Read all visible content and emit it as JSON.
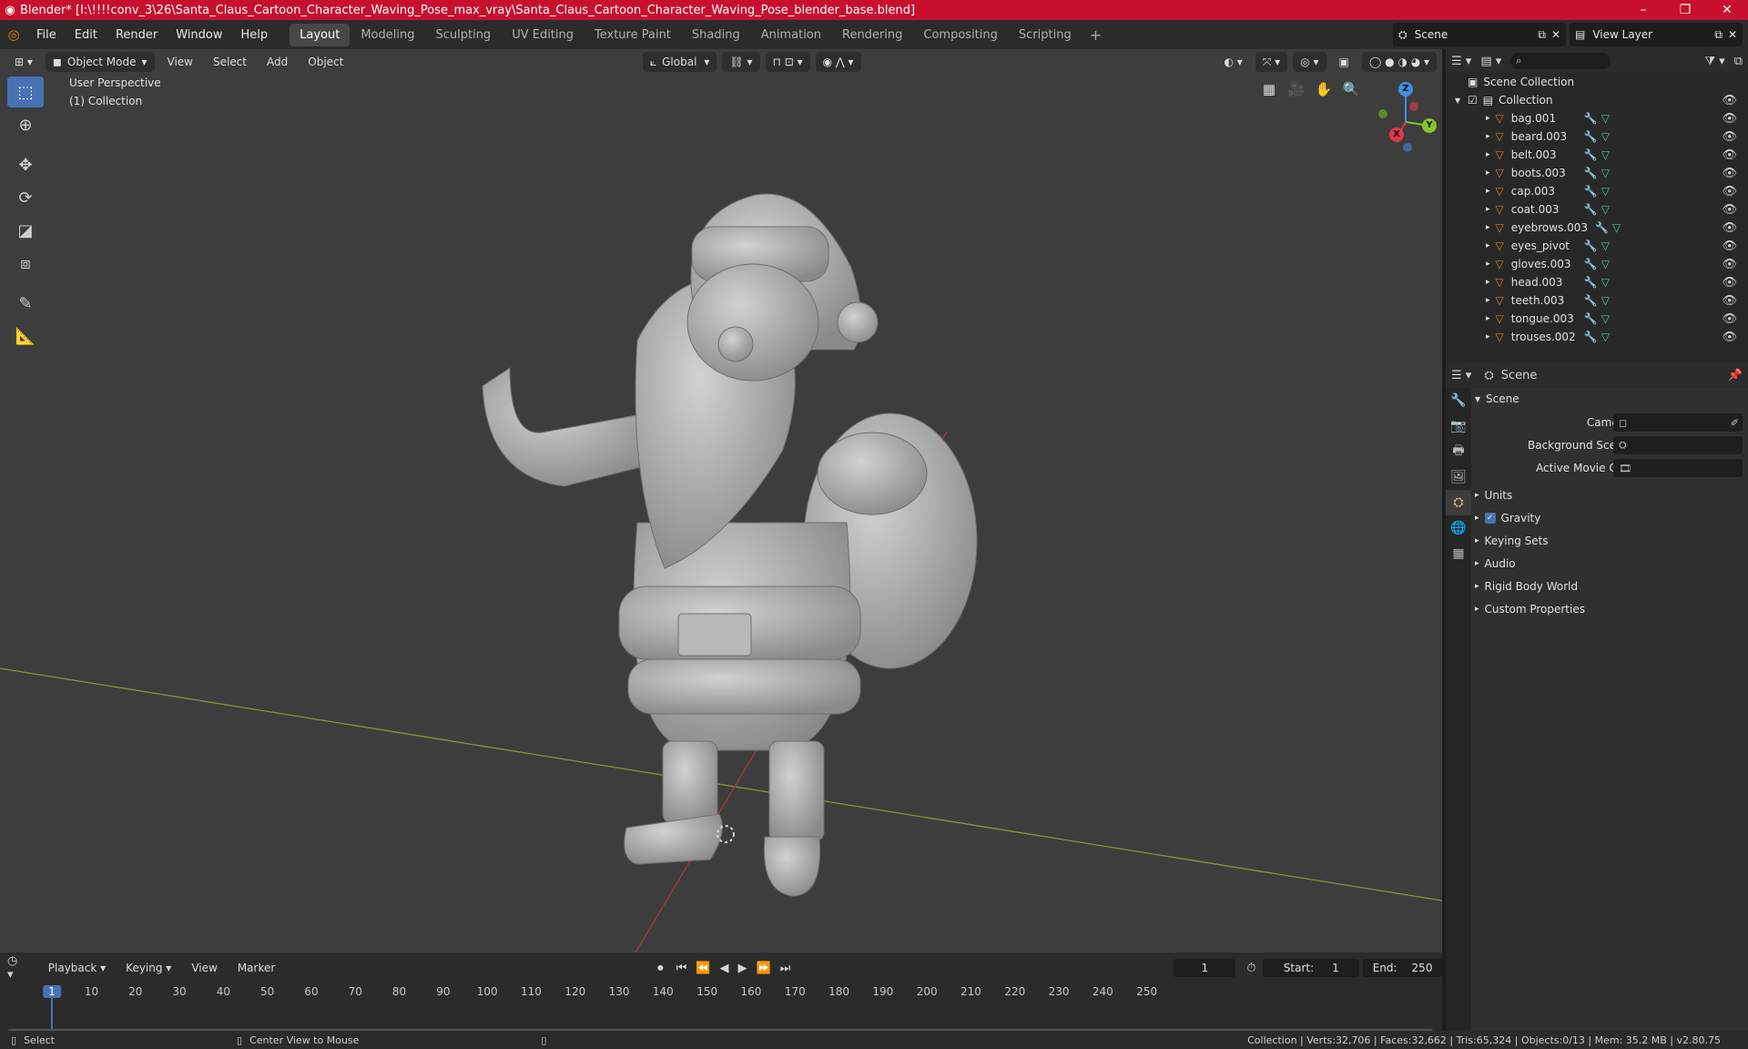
{
  "titlebar": {
    "title": "Blender* [I:\\!!!!conv_3\\26\\Santa_Claus_Cartoon_Character_Waving_Pose_max_vray\\Santa_Claus_Cartoon_Character_Waving_Pose_blender_base.blend]",
    "minimize": "–",
    "maximize": "❐",
    "close": "✕"
  },
  "menu": {
    "items": [
      "File",
      "Edit",
      "Render",
      "Window",
      "Help"
    ]
  },
  "workspaces": [
    "Layout",
    "Modeling",
    "Sculpting",
    "UV Editing",
    "Texture Paint",
    "Shading",
    "Animation",
    "Rendering",
    "Compositing",
    "Scripting"
  ],
  "active_workspace": "Layout",
  "scene_name": "Scene",
  "view_layer": "View Layer",
  "viewport": {
    "mode": "Object Mode",
    "menus": [
      "View",
      "Select",
      "Add",
      "Object"
    ],
    "orientation": "Global",
    "perspective_label": "User Perspective",
    "collection_label": "(1) Collection"
  },
  "gizmo": {
    "x": "X",
    "y": "Y",
    "z": "Z"
  },
  "outliner": {
    "root": "Scene Collection",
    "collection": "Collection",
    "objects": [
      "bag.001",
      "beard.003",
      "belt.003",
      "boots.003",
      "cap.003",
      "coat.003",
      "eyebrows.003",
      "eyes_pivot",
      "gloves.003",
      "head.003",
      "teeth.003",
      "tongue.003",
      "trouses.002"
    ]
  },
  "properties": {
    "header": "Scene",
    "panel": "Scene",
    "camera_label": "Camera",
    "background_scene_label": "Background Scene",
    "movie_clip_label": "Active Movie Clip",
    "sections": [
      "Units",
      "Gravity",
      "Keying Sets",
      "Audio",
      "Rigid Body World",
      "Custom Properties"
    ],
    "gravity_checked": true
  },
  "timeline": {
    "menus": [
      "Playback",
      "Keying",
      "View",
      "Marker"
    ],
    "current_frame": "1",
    "start_label": "Start:",
    "start": "1",
    "end_label": "End:",
    "end": "250",
    "ticks": [
      "1",
      "10",
      "20",
      "30",
      "40",
      "50",
      "60",
      "70",
      "80",
      "90",
      "100",
      "110",
      "120",
      "130",
      "140",
      "150",
      "160",
      "170",
      "180",
      "190",
      "200",
      "210",
      "220",
      "230",
      "240",
      "250"
    ]
  },
  "status": {
    "select": "Select",
    "center_view": "Center View to Mouse",
    "stats": "Collection | Verts:32,706 | Faces:32,662 | Tris:65,324 | Objects:0/13 | Mem: 35.2 MB | v2.80.75"
  },
  "colors": {
    "accent": "#4772b3",
    "titlebar": "#c8102e",
    "orange": "#e87d0d",
    "x_axis": "#e0364e",
    "y_axis": "#86c524",
    "z_axis": "#3d8fe0"
  }
}
